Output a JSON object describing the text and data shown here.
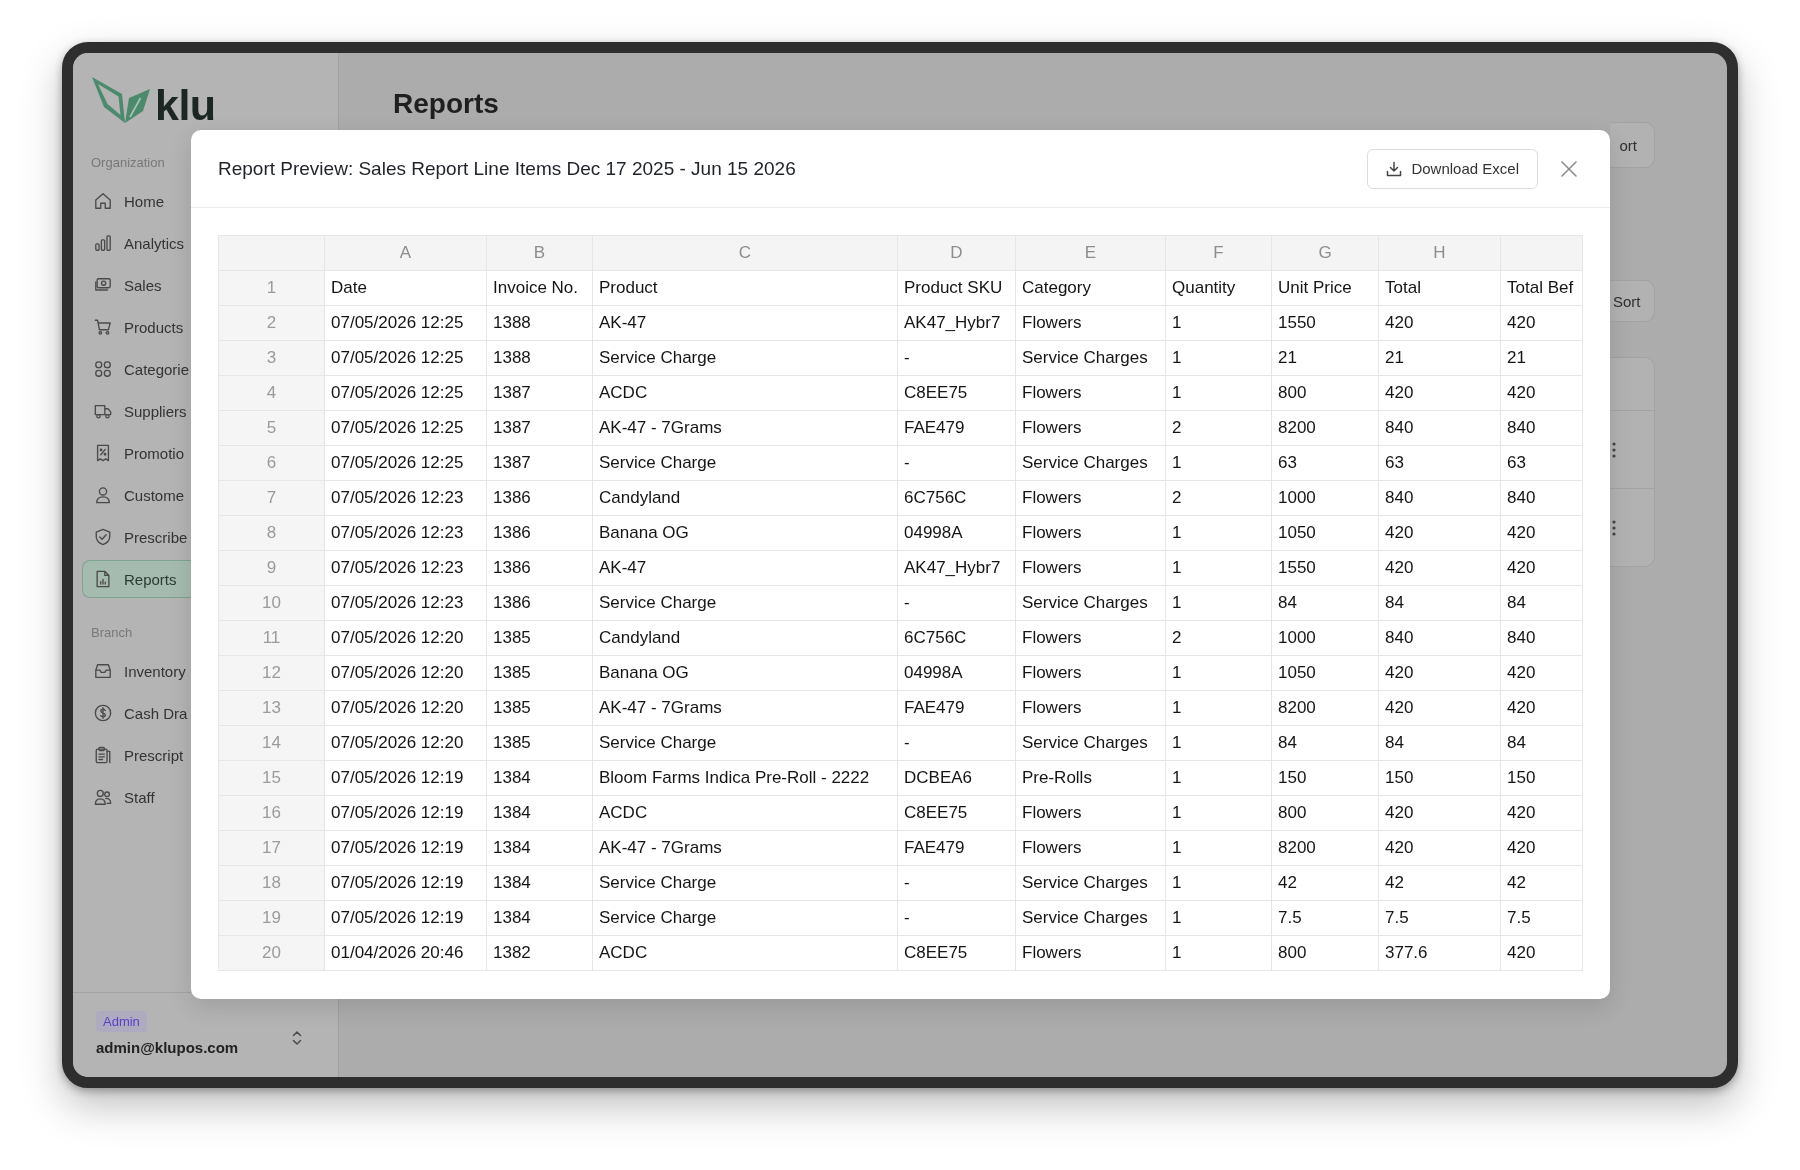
{
  "sidebar": {
    "logo": {
      "text": "klu"
    },
    "sections": [
      {
        "title": "Organization",
        "items": [
          {
            "label": "Home",
            "selected": false
          },
          {
            "label": "Analytics",
            "selected": false
          },
          {
            "label": "Sales",
            "selected": false
          },
          {
            "label": "Products",
            "selected": false
          },
          {
            "label": "Categorie",
            "selected": false
          },
          {
            "label": "Suppliers",
            "selected": false
          },
          {
            "label": "Promotio",
            "selected": false
          },
          {
            "label": "Custome",
            "selected": false
          },
          {
            "label": "Prescribe",
            "selected": false
          },
          {
            "label": "Reports",
            "selected": true
          }
        ]
      },
      {
        "title": "Branch",
        "items": [
          {
            "label": "Inventory",
            "selected": false
          },
          {
            "label": "Cash Dra",
            "selected": false
          },
          {
            "label": "Prescript",
            "selected": false
          },
          {
            "label": "Staff",
            "selected": false
          }
        ]
      }
    ],
    "account": {
      "role": "Admin",
      "email": "admin@klupos.com"
    }
  },
  "page": {
    "title": "Reports",
    "actions": [
      {
        "label": "ort"
      },
      {
        "label": "Sort"
      }
    ],
    "card": {
      "rows": [
        {
          "has_menu": true
        },
        {
          "has_menu": true
        }
      ]
    }
  },
  "dialog": {
    "title": "Report Preview: Sales Report Line Items Dec 17 2025 - Jun 15 2026",
    "download_button": "Download Excel",
    "sheet": {
      "column_letters": [
        "A",
        "B",
        "C",
        "D",
        "E",
        "F",
        "G",
        "H"
      ],
      "rows": [
        {
          "number": "1",
          "cells": [
            "Date",
            "Invoice No.",
            "Product",
            "Product SKU",
            "Category",
            "Quantity",
            "Unit Price",
            "Total",
            "Total Bef"
          ]
        },
        {
          "number": "2",
          "cells": [
            "07/05/2026 12:25",
            "1388",
            "AK-47",
            "AK47_Hybr7",
            "Flowers",
            "1",
            "1550",
            "420",
            "420"
          ]
        },
        {
          "number": "3",
          "cells": [
            "07/05/2026 12:25",
            "1388",
            "Service Charge",
            "-",
            "Service Charges",
            "1",
            "21",
            "21",
            "21"
          ]
        },
        {
          "number": "4",
          "cells": [
            "07/05/2026 12:25",
            "1387",
            "ACDC",
            "C8EE75",
            "Flowers",
            "1",
            "800",
            "420",
            "420"
          ]
        },
        {
          "number": "5",
          "cells": [
            "07/05/2026 12:25",
            "1387",
            "AK-47 - 7Grams",
            "FAE479",
            "Flowers",
            "2",
            "8200",
            "840",
            "840"
          ]
        },
        {
          "number": "6",
          "cells": [
            "07/05/2026 12:25",
            "1387",
            "Service Charge",
            "-",
            "Service Charges",
            "1",
            "63",
            "63",
            "63"
          ]
        },
        {
          "number": "7",
          "cells": [
            "07/05/2026 12:23",
            "1386",
            "Candyland",
            "6C756C",
            "Flowers",
            "2",
            "1000",
            "840",
            "840"
          ]
        },
        {
          "number": "8",
          "cells": [
            "07/05/2026 12:23",
            "1386",
            "Banana OG",
            "04998A",
            "Flowers",
            "1",
            "1050",
            "420",
            "420"
          ]
        },
        {
          "number": "9",
          "cells": [
            "07/05/2026 12:23",
            "1386",
            "AK-47",
            "AK47_Hybr7",
            "Flowers",
            "1",
            "1550",
            "420",
            "420"
          ]
        },
        {
          "number": "10",
          "cells": [
            "07/05/2026 12:23",
            "1386",
            "Service Charge",
            "-",
            "Service Charges",
            "1",
            "84",
            "84",
            "84"
          ]
        },
        {
          "number": "11",
          "cells": [
            "07/05/2026 12:20",
            "1385",
            "Candyland",
            "6C756C",
            "Flowers",
            "2",
            "1000",
            "840",
            "840"
          ]
        },
        {
          "number": "12",
          "cells": [
            "07/05/2026 12:20",
            "1385",
            "Banana OG",
            "04998A",
            "Flowers",
            "1",
            "1050",
            "420",
            "420"
          ]
        },
        {
          "number": "13",
          "cells": [
            "07/05/2026 12:20",
            "1385",
            "AK-47 - 7Grams",
            "FAE479",
            "Flowers",
            "1",
            "8200",
            "420",
            "420"
          ]
        },
        {
          "number": "14",
          "cells": [
            "07/05/2026 12:20",
            "1385",
            "Service Charge",
            "-",
            "Service Charges",
            "1",
            "84",
            "84",
            "84"
          ]
        },
        {
          "number": "15",
          "cells": [
            "07/05/2026 12:19",
            "1384",
            "Bloom Farms Indica Pre-Roll - 2222",
            "DCBEA6",
            "Pre-Rolls",
            "1",
            "150",
            "150",
            "150"
          ]
        },
        {
          "number": "16",
          "cells": [
            "07/05/2026 12:19",
            "1384",
            "ACDC",
            "C8EE75",
            "Flowers",
            "1",
            "800",
            "420",
            "420"
          ]
        },
        {
          "number": "17",
          "cells": [
            "07/05/2026 12:19",
            "1384",
            "AK-47 - 7Grams",
            "FAE479",
            "Flowers",
            "1",
            "8200",
            "420",
            "420"
          ]
        },
        {
          "number": "18",
          "cells": [
            "07/05/2026 12:19",
            "1384",
            "Service Charge",
            "-",
            "Service Charges",
            "1",
            "42",
            "42",
            "42"
          ]
        },
        {
          "number": "19",
          "cells": [
            "07/05/2026 12:19",
            "1384",
            "Service Charge",
            "-",
            "Service Charges",
            "1",
            "7.5",
            "7.5",
            "7.5"
          ]
        },
        {
          "number": "20",
          "cells": [
            "01/04/2026 20:46",
            "1382",
            "ACDC",
            "C8EE75",
            "Flowers",
            "1",
            "800",
            "377.6",
            "420"
          ]
        }
      ]
    }
  }
}
